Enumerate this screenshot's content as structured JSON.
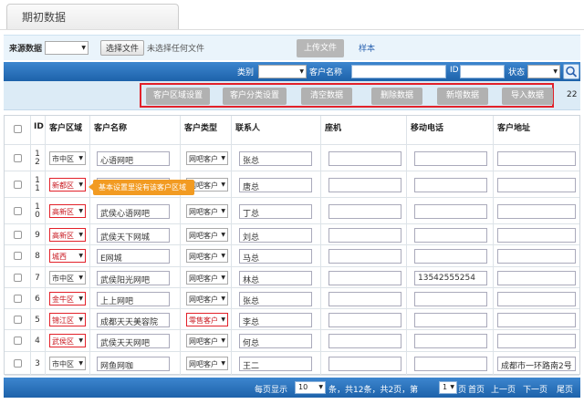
{
  "tab": {
    "title": "期初数据"
  },
  "import": {
    "source_label": "来源数据",
    "source_value": "",
    "choose_file": "选择文件",
    "no_file": "未选择任何文件",
    "upload": "上传文件",
    "sample": "样本"
  },
  "filter": {
    "category_label": "类别",
    "category_value": "客户资料",
    "name_label": "客户名称",
    "id_label": "ID",
    "status_label": "状态",
    "status_value": ""
  },
  "actions": [
    "客户区域设置",
    "客户分类设置",
    "清空数据",
    "删除数据",
    "新增数据",
    "导入数据"
  ],
  "total": "22",
  "columns": [
    "ID",
    "客户区域",
    "客户名称",
    "客户类型",
    "联系人",
    "座机",
    "移动电话",
    "客户地址"
  ],
  "rows": [
    {
      "id": "12",
      "region": "市中区",
      "name": "心语网吧",
      "type": "网吧客户",
      "contact": "张总",
      "phone": "",
      "mobile": "",
      "address": "",
      "region_err": false,
      "type_err": false
    },
    {
      "id": "11",
      "region": "新都区",
      "name": "",
      "type": "网吧客户",
      "contact": "唐总",
      "phone": "",
      "mobile": "",
      "address": "",
      "region_err": true,
      "type_err": false
    },
    {
      "id": "10",
      "region": "高新区",
      "name": "武侯心语网吧",
      "type": "网吧客户",
      "contact": "丁总",
      "phone": "",
      "mobile": "",
      "address": "",
      "region_err": true,
      "type_err": false
    },
    {
      "id": "9",
      "region": "高新区",
      "name": "武侯天下网城",
      "type": "网吧客户",
      "contact": "刘总",
      "phone": "",
      "mobile": "",
      "address": "",
      "region_err": true,
      "type_err": false
    },
    {
      "id": "8",
      "region": "城西",
      "name": "E网城",
      "type": "网吧客户",
      "contact": "马总",
      "phone": "",
      "mobile": "",
      "address": "",
      "region_err": true,
      "type_err": false
    },
    {
      "id": "7",
      "region": "市中区",
      "name": "武侯阳光网吧",
      "type": "网吧客户",
      "contact": "林总",
      "phone": "",
      "mobile": "13542555254",
      "address": "",
      "region_err": false,
      "type_err": false
    },
    {
      "id": "6",
      "region": "金牛区",
      "name": "上上网吧",
      "type": "网吧客户",
      "contact": "张总",
      "phone": "",
      "mobile": "",
      "address": "",
      "region_err": true,
      "type_err": false
    },
    {
      "id": "5",
      "region": "锦江区",
      "name": "成都天天美容院",
      "type": "零售客户",
      "contact": "李总",
      "phone": "",
      "mobile": "",
      "address": "",
      "region_err": true,
      "type_err": true
    },
    {
      "id": "4",
      "region": "武侯区",
      "name": "武侯天天网吧",
      "type": "网吧客户",
      "contact": "何总",
      "phone": "",
      "mobile": "",
      "address": "",
      "region_err": true,
      "type_err": false
    },
    {
      "id": "3",
      "region": "市中区",
      "name": "网鱼网咖",
      "type": "网吧客户",
      "contact": "王二",
      "phone": "",
      "mobile": "",
      "address": "成都市一环路南2号",
      "region_err": false,
      "type_err": false
    }
  ],
  "tooltip": "基本设置里没有该客户区域",
  "pager": {
    "per_page_label": "每页显示",
    "per_page": "10",
    "summary": "条，共12条，共2页，第",
    "page": "1",
    "page_suffix": "页",
    "first": "首页",
    "prev": "上一页",
    "next": "下一页",
    "last": "尾页"
  },
  "colors": {
    "bar_blue": "#2a72bd",
    "error_red": "#e2212a",
    "tooltip_orange": "#f29b22"
  }
}
